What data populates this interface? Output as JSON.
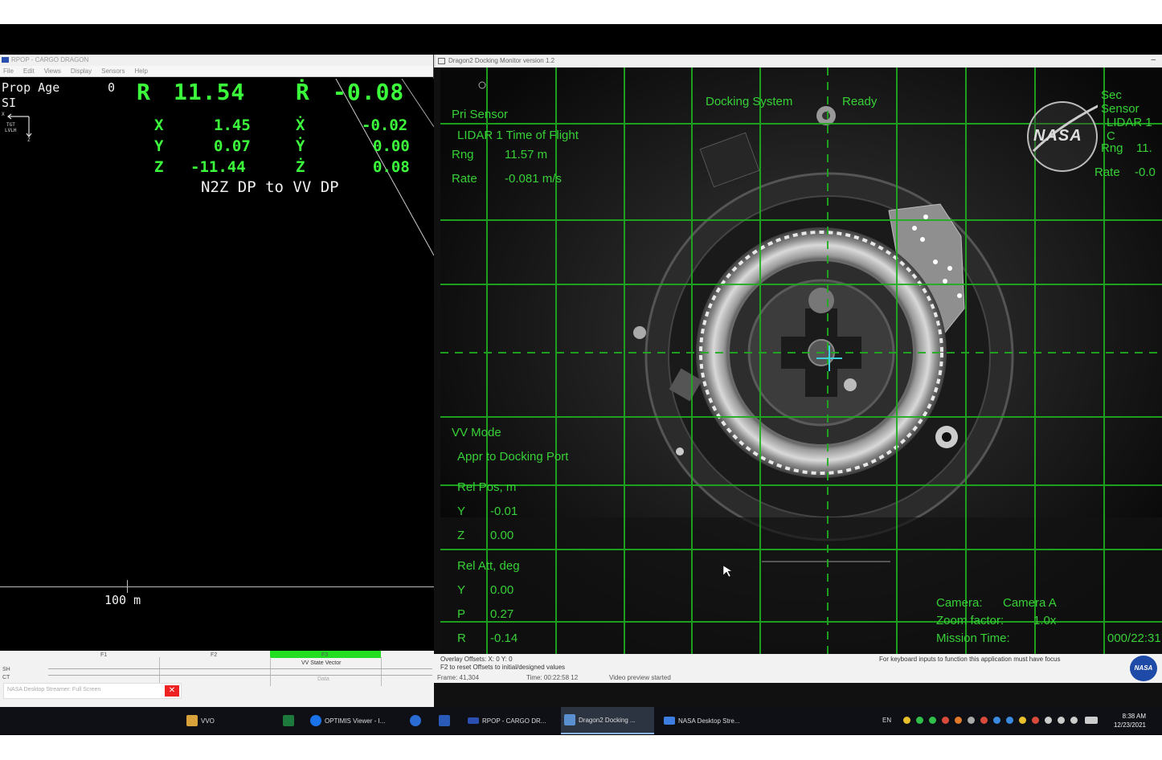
{
  "rpop": {
    "title": "RPOP - CARGO DRAGON",
    "menu": [
      "File",
      "Edit",
      "Views",
      "Display",
      "Sensors",
      "Help"
    ],
    "prop_age_label": "Prop Age",
    "prop_age_value": "0",
    "si_label": "SI",
    "tgt_label": "TGT",
    "lvlh_label": "LVLH",
    "axis_x": "X",
    "axis_z": "Z",
    "range_label": "R",
    "range_value": "11.54",
    "range_rate_label": "Ṙ",
    "range_rate_value": "-0.08",
    "pos": [
      {
        "label": "X",
        "value": "1.45",
        "rate_label": "Ẋ",
        "rate_value": "-0.02"
      },
      {
        "label": "Y",
        "value": "0.07",
        "rate_label": "Ẏ",
        "rate_value": "0.00"
      },
      {
        "label": "Z",
        "value": "-11.44",
        "rate_label": "Ż",
        "rate_value": "0.08"
      }
    ],
    "mode": "N2Z DP to VV DP",
    "scale": "100 m",
    "fkeys": [
      "F1",
      "F2",
      "F3"
    ],
    "f3_sub": "VV State Vector",
    "f3_sub2": "Data",
    "sh_label": "SH",
    "ct_label": "CT",
    "notification": "NASA Desktop Streamer: Full Screen",
    "notification_close": "✕"
  },
  "dragon": {
    "title": "Dragon2 Docking Monitor version 1.2",
    "minimize": "–",
    "docking_system_label": "Docking System",
    "docking_system_value": "Ready",
    "pri_sensor_label": "Pri Sensor",
    "pri_sensor_name": "LIDAR 1 Time of Flight",
    "rng_label": "Rng",
    "rng_value": "11.57 m",
    "rate_label": "Rate",
    "rate_value": "-0.081 m/s",
    "sec_sensor_label": "Sec Sensor",
    "sec_sensor_name": "LIDAR 1 C",
    "sec_rng_label": "Rng",
    "sec_rng_value": "11.",
    "sec_rate_label": "Rate",
    "sec_rate_value": "-0.0",
    "nasa_logo": "NASA",
    "vv_mode_label": "VV Mode",
    "vv_mode_value": "Appr to Docking Port",
    "rel_pos_label": "Rel Pos, m",
    "rel_pos": [
      {
        "label": "Y",
        "value": "-0.01"
      },
      {
        "label": "Z",
        "value": "0.00"
      }
    ],
    "rel_att_label": "Rel Att, deg",
    "rel_att": [
      {
        "label": "Y",
        "value": "0.00"
      },
      {
        "label": "P",
        "value": "0.27"
      },
      {
        "label": "R",
        "value": "-0.14"
      }
    ],
    "camera_label": "Camera:",
    "camera_value": "Camera A",
    "zoom_label": "Zoom factor:",
    "zoom_value": "1.0x",
    "mission_time_label": "Mission Time:",
    "mission_time_value": "000/22:31",
    "overlay_offsets": "Overlay Offsets:  X: 0     Y: 0",
    "f2_hint": "F2 to reset Offsets to initial/designed values",
    "frame": "Frame: 41,304",
    "time": "Time: 00:22:58 12",
    "video_status": "Video preview started",
    "focus_hint": "For keyboard inputs to function this application must have focus",
    "nasa_badge": "NASA"
  },
  "taskbar": {
    "items": [
      {
        "label": "VVO",
        "color": "#d8a23a"
      },
      {
        "label": "",
        "color": "#1e7a3c"
      },
      {
        "label": "OPTIMIS Viewer - I...",
        "color": "#1a73e8"
      },
      {
        "label": "",
        "color": "#2b6bd4"
      },
      {
        "label": "",
        "color": "#2b5bb8"
      },
      {
        "label": "RPOP - CARGO DR...",
        "color": "#2a4fb0"
      },
      {
        "label": "Dragon2 Docking ...",
        "color": "#5a8fd0"
      },
      {
        "label": "NASA Desktop Stre...",
        "color": "#3d7de0"
      }
    ],
    "lang": "EN",
    "clock_time": "8:38 AM",
    "clock_date": "12/23/2021"
  },
  "colors": {
    "hud_green": "#37d137",
    "plot_green": "#3cff3c",
    "grid_green": "#1fae1f"
  }
}
